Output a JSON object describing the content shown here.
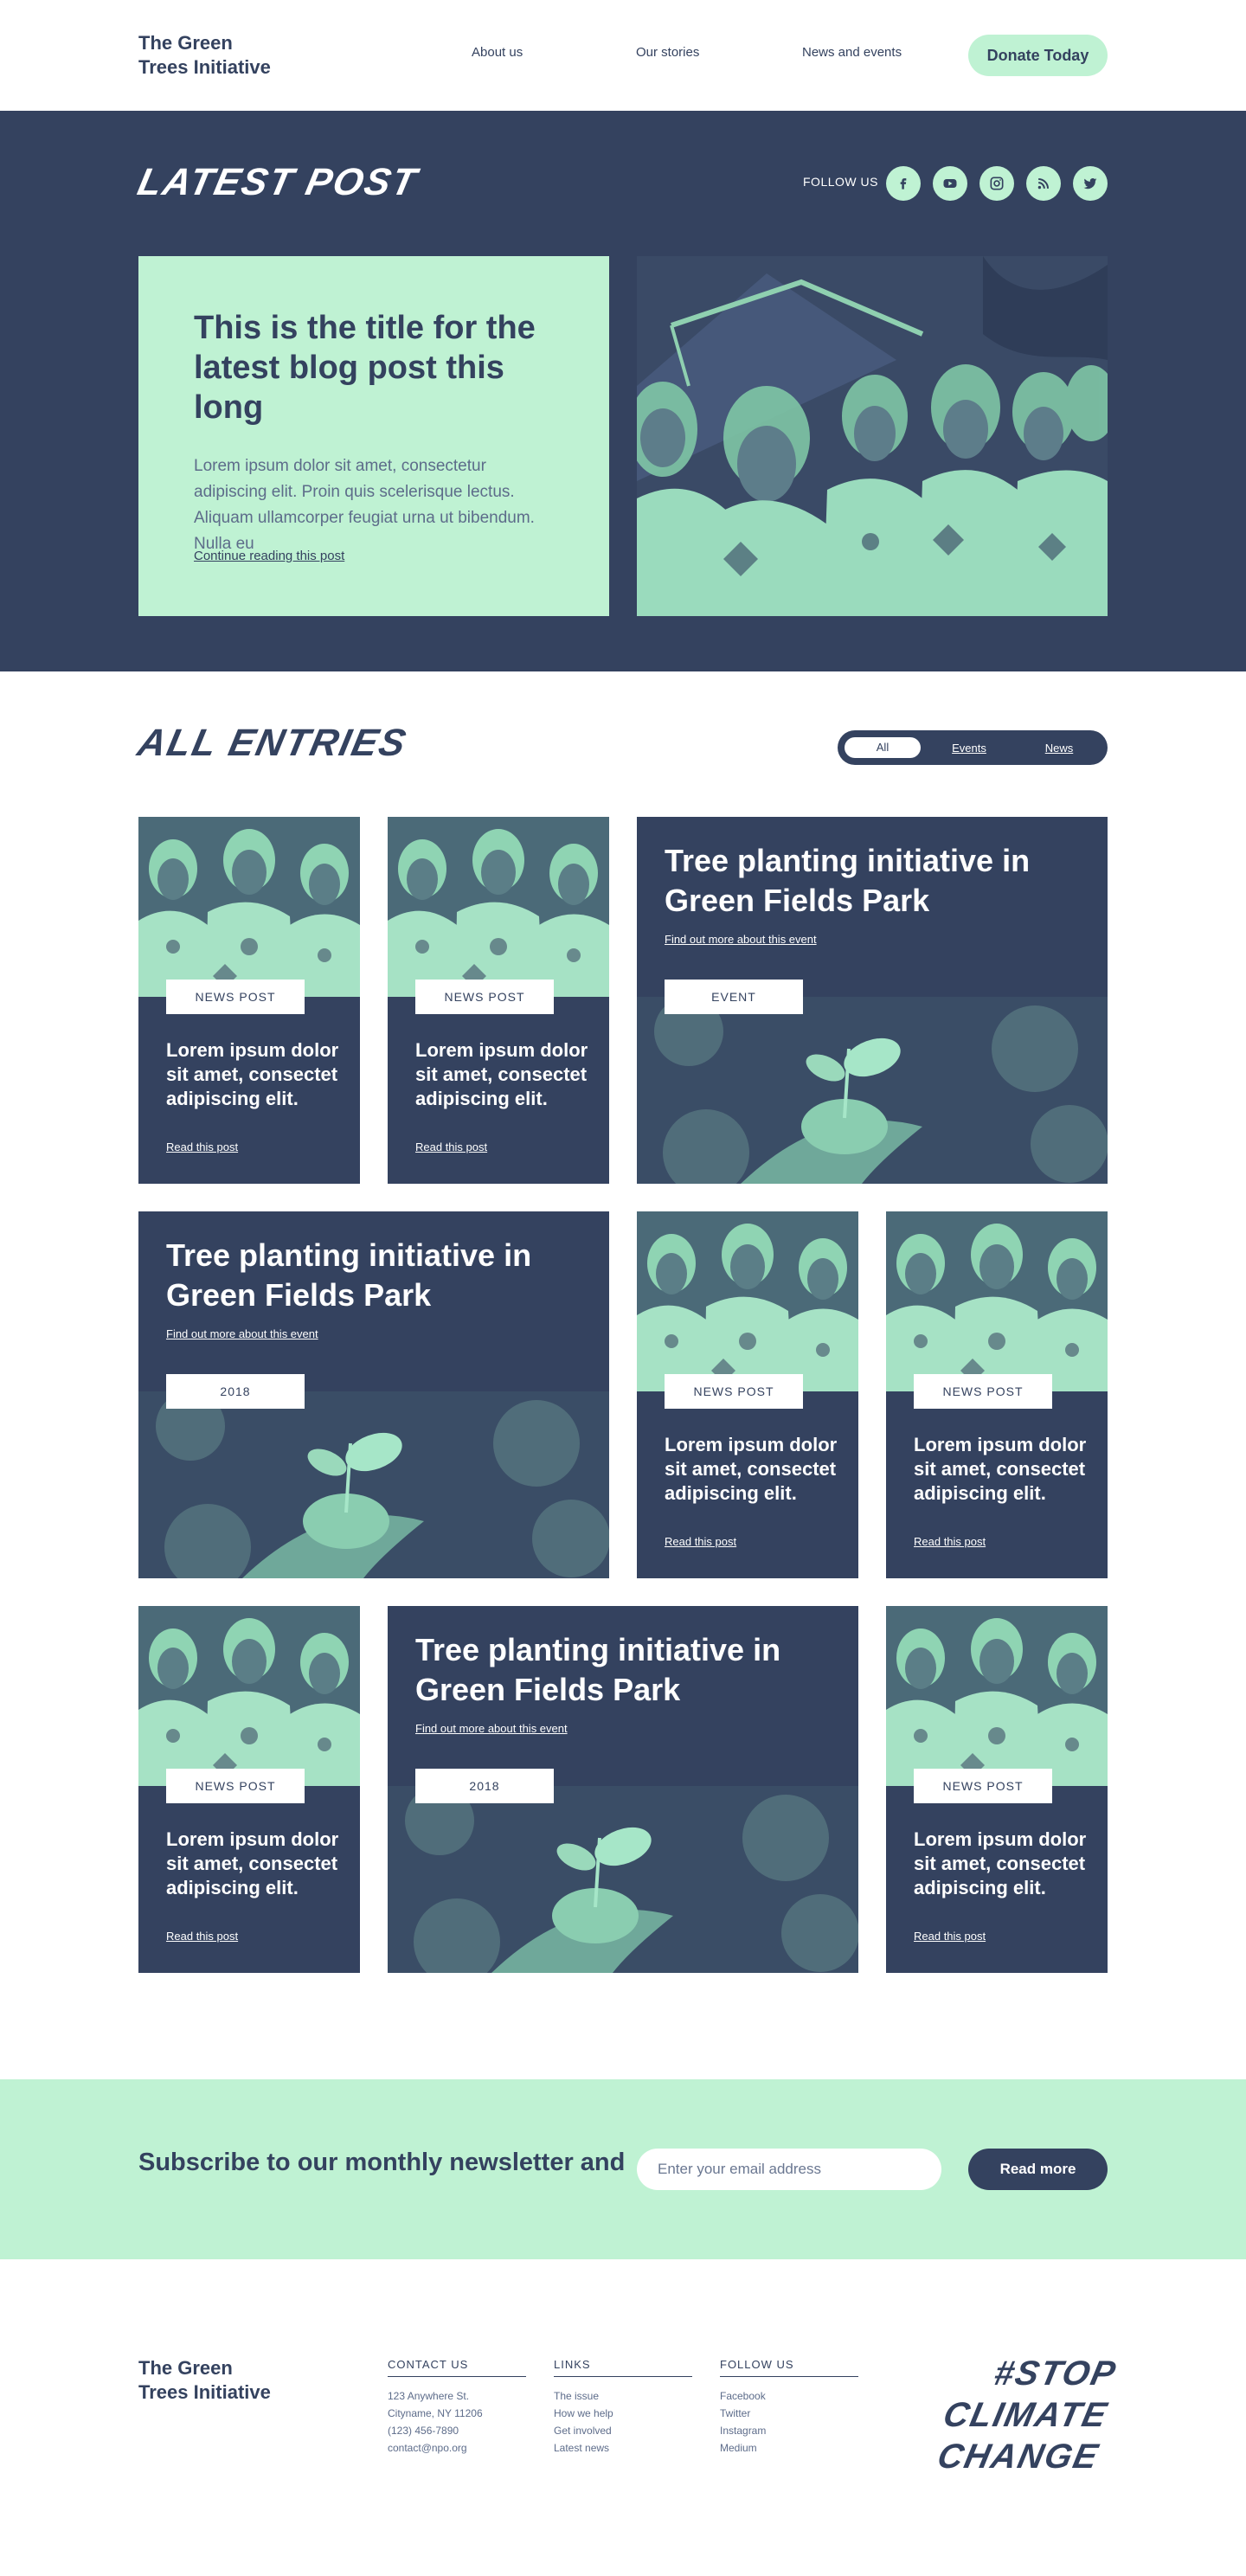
{
  "brand": {
    "name_line1": "The Green",
    "name_line2": "Trees Initiative"
  },
  "nav": {
    "items": [
      "About us",
      "Our stories",
      "News and events"
    ],
    "cta": "Donate Today"
  },
  "latest": {
    "section_title": "Latest Post",
    "follow_label": "FOLLOW US",
    "social_icons": [
      "facebook-icon",
      "youtube-icon",
      "instagram-icon",
      "rss-icon",
      "twitter-icon"
    ],
    "post_title": "This is the title for the latest blog post this long",
    "post_excerpt": "Lorem ipsum dolor sit amet, consectetur adipiscing elit. Proin quis scelerisque lectus. Aliquam ullamcorper feugiat urna ut bibendum. Nulla eu",
    "continue_label": "Continue reading this post"
  },
  "entries": {
    "section_title": "All Entries",
    "filters": [
      "All",
      "Events",
      "News"
    ],
    "cards": [
      {
        "type": "news",
        "tag": "NEWS POST",
        "title": "Lorem ipsum dolor sit amet, consectet adipiscing elit.",
        "link": "Read this post"
      },
      {
        "type": "news",
        "tag": "NEWS POST",
        "title": "Lorem ipsum dolor sit amet, consectet adipiscing elit.",
        "link": "Read this post"
      },
      {
        "type": "event",
        "tag": "EVENT",
        "title": "Tree planting initiative in Green Fields Park",
        "link": "Find out more about this event"
      },
      {
        "type": "event",
        "tag": "2018",
        "title": "Tree planting initiative in Green Fields Park",
        "link": "Find out more about this event"
      },
      {
        "type": "news",
        "tag": "NEWS POST",
        "title": "Lorem ipsum dolor sit amet, consectet adipiscing elit.",
        "link": "Read this post"
      },
      {
        "type": "news",
        "tag": "NEWS POST",
        "title": "Lorem ipsum dolor sit amet, consectet adipiscing elit.",
        "link": "Read this post"
      },
      {
        "type": "news",
        "tag": "NEWS POST",
        "title": "Lorem ipsum dolor sit amet, consectet adipiscing elit.",
        "link": "Read this post"
      },
      {
        "type": "event",
        "tag": "2018",
        "title": "Tree planting initiative in Green Fields Park",
        "link": "Find out more about this event"
      },
      {
        "type": "news",
        "tag": "NEWS POST",
        "title": "Lorem ipsum dolor sit amet, consectet adipiscing elit.",
        "link": "Read this post"
      }
    ]
  },
  "newsletter": {
    "heading": "Subscribe to our monthly newsletter and",
    "placeholder": "Enter your email address",
    "button": "Read more"
  },
  "footer": {
    "contact": {
      "heading": "CONTACT US",
      "lines": [
        "123 Anywhere St.",
        "Cityname, NY 11206",
        "(123) 456-7890",
        "contact@npo.org"
      ]
    },
    "links": {
      "heading": "LINKS",
      "lines": [
        "The issue",
        "How we help",
        "Get involved",
        "Latest news"
      ]
    },
    "follow": {
      "heading": "FOLLOW US",
      "lines": [
        "Facebook",
        "Twitter",
        "Instagram",
        "Medium"
      ]
    },
    "slogan": [
      "#STOP",
      "CLIMATE",
      "CHANGE"
    ]
  },
  "colors": {
    "navy": "#34425f",
    "mint": "#bff2d3",
    "white": "#ffffff"
  }
}
